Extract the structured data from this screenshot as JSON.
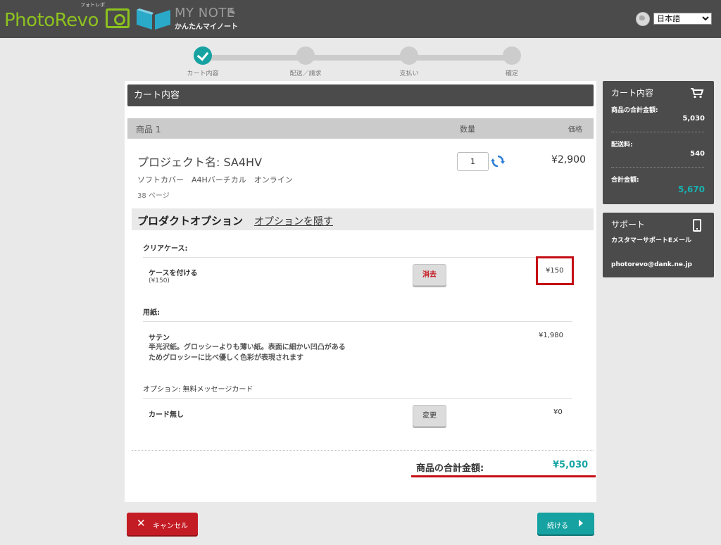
{
  "header": {
    "brand": "PhotoRevo",
    "brand_sub": "フォトレボ",
    "mynote_title": "MY NOTE",
    "mynote_sub": "かんたんマイノート",
    "language": "日本語",
    "language_options": [
      "日本語"
    ]
  },
  "steps": [
    {
      "label": "カート内容",
      "state": "done"
    },
    {
      "label": "配送／請求",
      "state": "pending"
    },
    {
      "label": "支払い",
      "state": "pending"
    },
    {
      "label": "確定",
      "state": "pending"
    }
  ],
  "cart": {
    "title": "カート内容",
    "col_product": "商品 1",
    "col_qty": "数量",
    "col_price": "価格",
    "project_name": "プロジェクト名: SA4HV",
    "spec": "ソフトカバー　A4Hバーチカル　オンライン",
    "pages": "38 ページ",
    "quantity": "1",
    "price": "¥2,900"
  },
  "options": {
    "title": "プロダクトオプション",
    "hide_link": "オプションを隠す",
    "clear_case": {
      "heading": "クリアケース:",
      "name": "ケースを付ける",
      "sub": "(¥150)",
      "button": "消去",
      "price": "¥150"
    },
    "paper": {
      "heading": "用紙:",
      "name": "サテン",
      "desc": "半光沢紙。グロッシーよりも薄い紙。表面に細かい凹凸があるためグロッシーに比べ優しく色彩が表現されます",
      "price": "¥1,980"
    },
    "message_card": {
      "heading": "オプション: 無料メッセージカード",
      "name": "カード無し",
      "button": "変更",
      "price": "¥0"
    }
  },
  "subtotal": {
    "label": "商品の合計金額:",
    "value": "¥5,030"
  },
  "buttons": {
    "cancel": "キャンセル",
    "continue": "続ける"
  },
  "summary": {
    "title": "カート内容",
    "items_label": "商品の合計金額:",
    "items_value": "5,030",
    "shipping_label": "配送料:",
    "shipping_value": "540",
    "total_label": "合計金額:",
    "total_value": "5,670"
  },
  "support": {
    "title": "サポート",
    "text": "カスタマーサポートEメール",
    "email": "photorevo@dank.ne.jp"
  },
  "colors": {
    "header_bg": "#4b4b4b",
    "accent_teal": "#17a2a2",
    "alert_red": "#c40e14",
    "brand_green": "#8dc21f"
  }
}
